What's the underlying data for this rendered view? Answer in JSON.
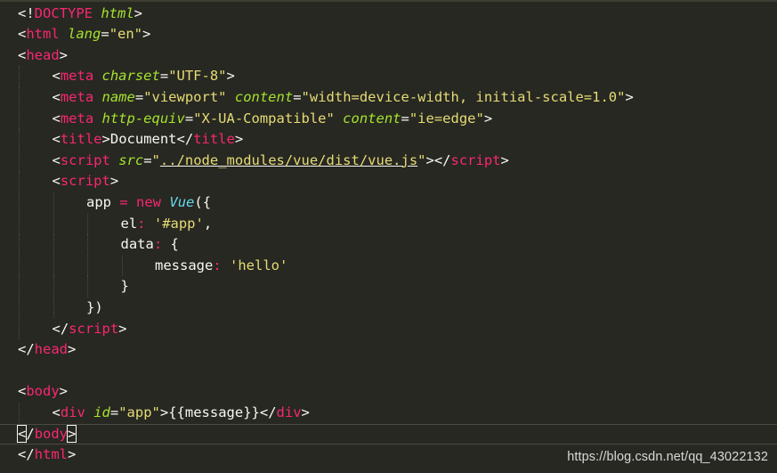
{
  "editor": {
    "lines": [
      {
        "indent": 0,
        "tokens": [
          {
            "t": "<!",
            "c": "punct"
          },
          {
            "t": "DOCTYPE",
            "c": "tag"
          },
          {
            "t": " ",
            "c": "plain"
          },
          {
            "t": "html",
            "c": "attr"
          },
          {
            "t": ">",
            "c": "punct"
          }
        ]
      },
      {
        "indent": 0,
        "tokens": [
          {
            "t": "<",
            "c": "punct"
          },
          {
            "t": "html",
            "c": "tag"
          },
          {
            "t": " ",
            "c": "plain"
          },
          {
            "t": "lang",
            "c": "attr"
          },
          {
            "t": "=",
            "c": "punct"
          },
          {
            "t": "\"en\"",
            "c": "str"
          },
          {
            "t": ">",
            "c": "punct"
          }
        ]
      },
      {
        "indent": 0,
        "tokens": [
          {
            "t": "<",
            "c": "punct"
          },
          {
            "t": "head",
            "c": "tag"
          },
          {
            "t": ">",
            "c": "punct"
          }
        ]
      },
      {
        "indent": 1,
        "tokens": [
          {
            "t": "<",
            "c": "punct"
          },
          {
            "t": "meta",
            "c": "tag"
          },
          {
            "t": " ",
            "c": "plain"
          },
          {
            "t": "charset",
            "c": "attr"
          },
          {
            "t": "=",
            "c": "punct"
          },
          {
            "t": "\"UTF-8\"",
            "c": "str"
          },
          {
            "t": ">",
            "c": "punct"
          }
        ]
      },
      {
        "indent": 1,
        "tokens": [
          {
            "t": "<",
            "c": "punct"
          },
          {
            "t": "meta",
            "c": "tag"
          },
          {
            "t": " ",
            "c": "plain"
          },
          {
            "t": "name",
            "c": "attr"
          },
          {
            "t": "=",
            "c": "punct"
          },
          {
            "t": "\"viewport\"",
            "c": "str"
          },
          {
            "t": " ",
            "c": "plain"
          },
          {
            "t": "content",
            "c": "attr"
          },
          {
            "t": "=",
            "c": "punct"
          },
          {
            "t": "\"width=device-width, initial-scale=1.0\"",
            "c": "str"
          },
          {
            "t": ">",
            "c": "punct"
          }
        ]
      },
      {
        "indent": 1,
        "tokens": [
          {
            "t": "<",
            "c": "punct"
          },
          {
            "t": "meta",
            "c": "tag"
          },
          {
            "t": " ",
            "c": "plain"
          },
          {
            "t": "http-equiv",
            "c": "attr"
          },
          {
            "t": "=",
            "c": "punct"
          },
          {
            "t": "\"X-UA-Compatible\"",
            "c": "str"
          },
          {
            "t": " ",
            "c": "plain"
          },
          {
            "t": "content",
            "c": "attr"
          },
          {
            "t": "=",
            "c": "punct"
          },
          {
            "t": "\"ie=edge\"",
            "c": "str"
          },
          {
            "t": ">",
            "c": "punct"
          }
        ]
      },
      {
        "indent": 1,
        "tokens": [
          {
            "t": "<",
            "c": "punct"
          },
          {
            "t": "title",
            "c": "tag"
          },
          {
            "t": ">",
            "c": "punct"
          },
          {
            "t": "Document",
            "c": "plain"
          },
          {
            "t": "</",
            "c": "punct"
          },
          {
            "t": "title",
            "c": "tag"
          },
          {
            "t": ">",
            "c": "punct"
          }
        ]
      },
      {
        "indent": 1,
        "tokens": [
          {
            "t": "<",
            "c": "punct"
          },
          {
            "t": "script",
            "c": "tag"
          },
          {
            "t": " ",
            "c": "plain"
          },
          {
            "t": "src",
            "c": "attr"
          },
          {
            "t": "=",
            "c": "punct"
          },
          {
            "t": "\"",
            "c": "str"
          },
          {
            "t": "../node_modules/vue/dist/vue.js",
            "c": "str-ul"
          },
          {
            "t": "\"",
            "c": "str"
          },
          {
            "t": "></",
            "c": "punct"
          },
          {
            "t": "script",
            "c": "tag"
          },
          {
            "t": ">",
            "c": "punct"
          }
        ]
      },
      {
        "indent": 1,
        "tokens": [
          {
            "t": "<",
            "c": "punct"
          },
          {
            "t": "script",
            "c": "tag"
          },
          {
            "t": ">",
            "c": "punct"
          }
        ]
      },
      {
        "indent": 2,
        "tokens": [
          {
            "t": "app ",
            "c": "plain"
          },
          {
            "t": "=",
            "c": "kw"
          },
          {
            "t": " ",
            "c": "plain"
          },
          {
            "t": "new",
            "c": "kw"
          },
          {
            "t": " ",
            "c": "plain"
          },
          {
            "t": "Vue",
            "c": "cls"
          },
          {
            "t": "({",
            "c": "plain"
          }
        ]
      },
      {
        "indent": 3,
        "tokens": [
          {
            "t": "el",
            "c": "plain"
          },
          {
            "t": ":",
            "c": "colon"
          },
          {
            "t": " ",
            "c": "plain"
          },
          {
            "t": "'#app'",
            "c": "str"
          },
          {
            "t": ",",
            "c": "plain"
          }
        ]
      },
      {
        "indent": 3,
        "tokens": [
          {
            "t": "data",
            "c": "plain"
          },
          {
            "t": ":",
            "c": "colon"
          },
          {
            "t": " {",
            "c": "plain"
          }
        ]
      },
      {
        "indent": 4,
        "tokens": [
          {
            "t": "message",
            "c": "plain"
          },
          {
            "t": ":",
            "c": "colon"
          },
          {
            "t": " ",
            "c": "plain"
          },
          {
            "t": "'hello'",
            "c": "str"
          }
        ]
      },
      {
        "indent": 3,
        "tokens": [
          {
            "t": "}",
            "c": "plain"
          }
        ]
      },
      {
        "indent": 2,
        "tokens": [
          {
            "t": "})",
            "c": "plain"
          }
        ]
      },
      {
        "indent": 1,
        "tokens": [
          {
            "t": "</",
            "c": "punct"
          },
          {
            "t": "script",
            "c": "tag"
          },
          {
            "t": ">",
            "c": "punct"
          }
        ]
      },
      {
        "indent": 0,
        "tokens": [
          {
            "t": "</",
            "c": "punct"
          },
          {
            "t": "head",
            "c": "tag"
          },
          {
            "t": ">",
            "c": "punct"
          }
        ]
      },
      {
        "indent": 0,
        "tokens": []
      },
      {
        "indent": 0,
        "tokens": [
          {
            "t": "<",
            "c": "punct"
          },
          {
            "t": "body",
            "c": "tag"
          },
          {
            "t": ">",
            "c": "punct"
          }
        ]
      },
      {
        "indent": 1,
        "tokens": [
          {
            "t": "<",
            "c": "punct"
          },
          {
            "t": "div",
            "c": "tag"
          },
          {
            "t": " ",
            "c": "plain"
          },
          {
            "t": "id",
            "c": "attr"
          },
          {
            "t": "=",
            "c": "punct"
          },
          {
            "t": "\"app\"",
            "c": "str"
          },
          {
            "t": ">",
            "c": "punct"
          },
          {
            "t": "{{message}}",
            "c": "plain"
          },
          {
            "t": "</",
            "c": "punct"
          },
          {
            "t": "div",
            "c": "tag"
          },
          {
            "t": ">",
            "c": "punct"
          }
        ]
      },
      {
        "indent": 0,
        "active": true,
        "tokens": [
          {
            "t": "<",
            "c": "punct-box"
          },
          {
            "t": "/",
            "c": "punct"
          },
          {
            "t": "body",
            "c": "tag"
          },
          {
            "t": ">",
            "c": "punct-box"
          }
        ]
      },
      {
        "indent": 0,
        "tokens": [
          {
            "t": "</",
            "c": "punct"
          },
          {
            "t": "html",
            "c": "tag"
          },
          {
            "t": ">",
            "c": "punct"
          }
        ]
      }
    ]
  },
  "watermark": {
    "text": "https://blog.csdn.net/qq_43022132"
  },
  "colors": {
    "background": "#272822",
    "tag": "#f92672",
    "attribute": "#a6e22e",
    "string": "#e6db74",
    "class": "#66d9ef",
    "text": "#f8f8f2"
  }
}
